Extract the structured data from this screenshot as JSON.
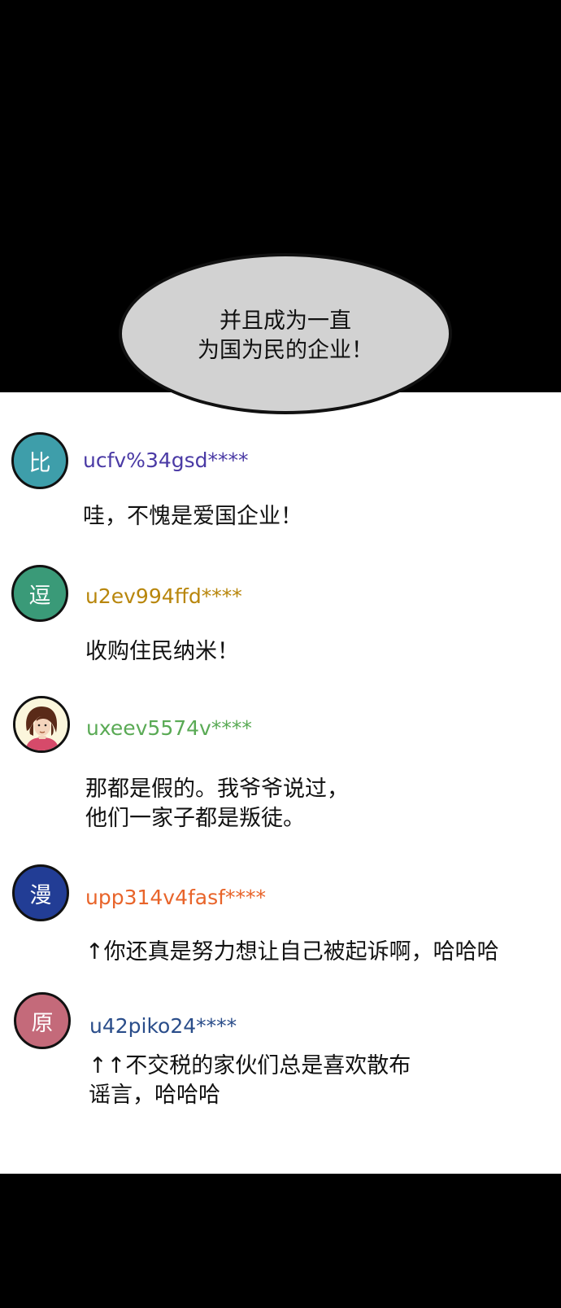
{
  "speech_bubble": {
    "lines": [
      "并且成为一直",
      "为国为民的企业！"
    ]
  },
  "comments": [
    {
      "avatar_char": "比",
      "avatar_color": "#3e9eaa",
      "username": "ucfv%34gsd****",
      "username_color": "#4a3aa5",
      "lines": [
        "哇，不愧是爱国企业！"
      ]
    },
    {
      "avatar_char": "逗",
      "avatar_color": "#3a9a78",
      "username": "u2ev994ffd****",
      "username_color": "#b8860b",
      "lines": [
        "收购住民纳米！"
      ]
    },
    {
      "avatar_icon": "person-portrait-icon",
      "username": "uxeev5574v****",
      "username_color": "#5aaa55",
      "lines": [
        "那都是假的。我爷爷说过，",
        "他们一家子都是叛徒。"
      ]
    },
    {
      "avatar_char": "漫",
      "avatar_color": "#223d95",
      "username": "upp314v4fasf****",
      "username_color": "#e8642a",
      "lines": [
        "↑你还真是努力想让自己被起诉啊，哈哈哈"
      ]
    },
    {
      "avatar_char": "原",
      "avatar_color": "#c46a7a",
      "username": "u42piko24****",
      "username_color": "#2a4d8a",
      "lines": [
        "↑↑不交税的家伙们总是喜欢散布",
        "谣言，哈哈哈"
      ]
    }
  ]
}
